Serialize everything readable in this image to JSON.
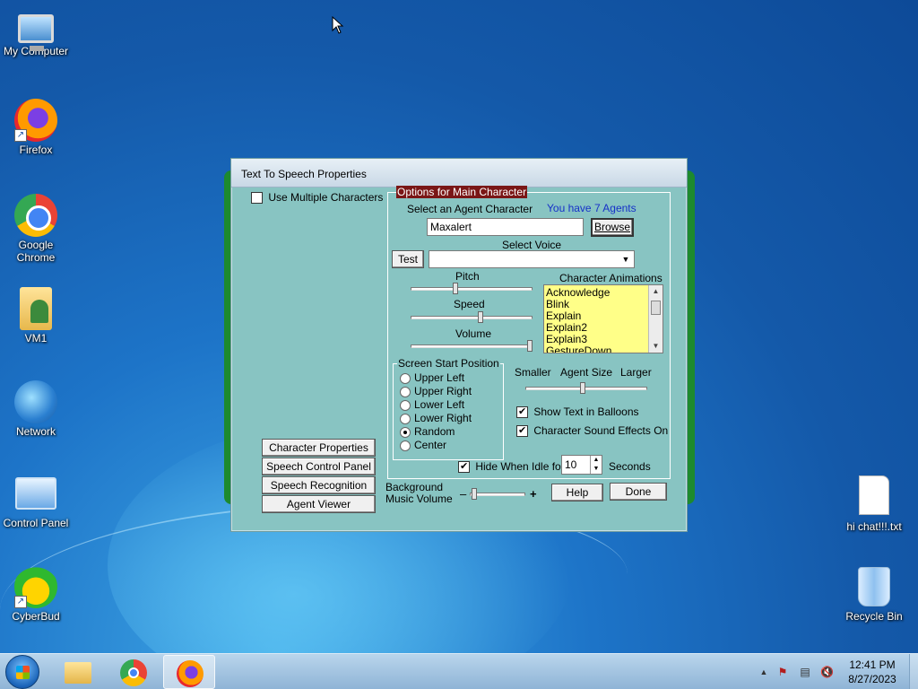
{
  "desktop": {
    "icons": [
      {
        "label": "My Computer",
        "icon": "computer-icon"
      },
      {
        "label": "Firefox",
        "icon": "firefox-icon"
      },
      {
        "label": "Google Chrome",
        "icon": "chrome-icon"
      },
      {
        "label": "VM1",
        "icon": "user-folder-icon"
      },
      {
        "label": "Network",
        "icon": "network-icon"
      },
      {
        "label": "Control Panel",
        "icon": "control-panel-icon"
      },
      {
        "label": "CyberBud",
        "icon": "cyberbud-icon"
      },
      {
        "label": "hi chat!!!.txt",
        "icon": "text-file-icon"
      },
      {
        "label": "Recycle Bin",
        "icon": "recycle-bin-icon"
      }
    ]
  },
  "dialog": {
    "title": "Text To Speech Properties",
    "use_multiple_label": "Use Multiple Characters",
    "use_multiple_checked": false,
    "main_group_title": "Options for Main Character",
    "select_agent_label": "Select an Agent Character",
    "agents_count_text": "You have 7 Agents",
    "agent_value": "Maxalert",
    "browse_label": "Browse",
    "select_voice_label": "Select Voice",
    "voice_value": "",
    "test_label": "Test",
    "pitch_label": "Pitch",
    "speed_label": "Speed",
    "volume_label": "Volume",
    "pitch_level": 0.36,
    "speed_level": 0.58,
    "volume_level": 1.0,
    "animations_label": "Character Animations",
    "animations": [
      "Acknowledge",
      "Blink",
      "Explain",
      "Explain2",
      "Explain3",
      "GestureDown"
    ],
    "screen_start_title": "Screen Start Position",
    "positions": [
      "Upper Left",
      "Upper Right",
      "Lower Left",
      "Lower Right",
      "Random",
      "Center"
    ],
    "selected_position": "Random",
    "smaller_label": "Smaller",
    "agent_size_label": "Agent Size",
    "larger_label": "Larger",
    "agent_size_level": 0.47,
    "show_text_label": "Show Text in Balloons",
    "show_text_checked": true,
    "sound_effects_label": "Character Sound Effects On",
    "sound_effects_checked": true,
    "hide_idle_label": "Hide When Idle for",
    "hide_idle_checked": true,
    "idle_value": "10",
    "seconds_label": "Seconds",
    "bg_music_label_1": "Background",
    "bg_music_label_2": "Music Volume",
    "minus": "–",
    "plus": "+",
    "bg_music_level": 0.04,
    "help_label": "Help",
    "done_label": "Done",
    "side_buttons": [
      "Character Properties",
      "Speech Control Panel",
      "Speech Recognition",
      "Agent Viewer"
    ]
  },
  "taskbar": {
    "time": "12:41 PM",
    "date": "8/27/2023",
    "colors": {
      "accent": "#1d8a2e",
      "dialog_bg": "#88c4c2",
      "list_bg": "#ffff88"
    }
  }
}
